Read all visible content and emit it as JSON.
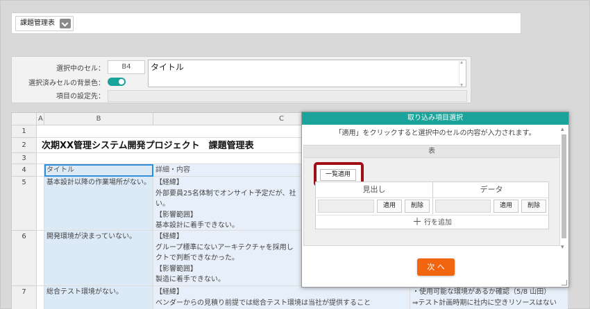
{
  "toolbar": {
    "sheet_name": "課題管理表"
  },
  "cell_panel": {
    "selected_cell_label": "選択中のセル：",
    "selected_cell": "B4",
    "cell_value": "タイトル",
    "bg_color_label": "選択済みセルの背景色：",
    "bg_toggle_on": true,
    "item_setting_label": "項目の設定先："
  },
  "sheet": {
    "columns": [
      "A",
      "B",
      "C"
    ],
    "rows": [
      "1",
      "2",
      "3",
      "4",
      "5",
      "6",
      "7"
    ],
    "title": "次期XX管理システム開発プロジェクト　課題管理表",
    "header_b": "タイトル",
    "header_c": "詳細・内容",
    "row5_b": "基本設計以降の作業場所がない。",
    "row5_c": "【経緯】\n外部要員25名体制でオンサイト予定だが、社\nい。\n【影響範囲】\n基本設計に着手できない。",
    "row6_b": "開発環境が決まっていない。",
    "row6_c": "【経緯】\nグループ標準にないアーキテクチャを採用し\nクトで判断できなかった。\n【影響範囲】\n製造に着手できない。",
    "row7_b": "総合テスト環境がない。",
    "row7_c": "【経緯】\nベンダーからの見積り前提では総合テスト環境は当社が提供すること",
    "row7_d": "・使用可能な環境があるか確認（5/8 山田）\n⇒テスト計画時期に社内に空きリソースはない"
  },
  "dialog": {
    "title": "取り込み項目選択",
    "description": "「適用」をクリックすると選択中のセルの内容が入力されます。",
    "table_label": "表",
    "bulk_apply": "一覧適用",
    "col_heading": "見出し",
    "col_data": "データ",
    "apply": "適用",
    "delete": "削除",
    "add_row": "行を追加",
    "next": "次 へ"
  },
  "colors": {
    "accent": "#1aa39a",
    "next_button": "#f2650f",
    "highlight_border": "#a00f15",
    "selected_cell_fill": "#dce9f7"
  }
}
